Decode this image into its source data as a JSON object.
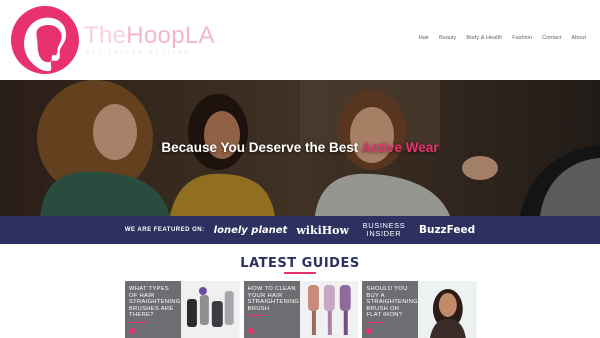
{
  "brand": {
    "logo_the": "The",
    "logo_name": "HoopLA",
    "tagline": "ALL THINGS STYLISH",
    "accent_color": "#e8326d"
  },
  "nav": {
    "items": [
      "Hair",
      "Beauty",
      "Body & Health",
      "Fashion",
      "Contact",
      "About"
    ]
  },
  "hero": {
    "headline_main": "Because You Deserve the Best",
    "headline_accent": "Active Wear"
  },
  "featured": {
    "label": "WE ARE FEATURED ON:",
    "brands": [
      "lonely planet",
      "wikiHow",
      "BUSINESS INSIDER",
      "BuzzFeed"
    ]
  },
  "guides": {
    "title": "LATEST GUIDES",
    "cards": [
      {
        "title": "WHAT TYPES OF HAIR STRAIGHTENING BRUSHES ARE THERE?"
      },
      {
        "title": "HOW TO CLEAN YOUR HAIR STRAIGHTENING BRUSH"
      },
      {
        "title": "SHOULD YOU BUY A STRAIGHTENING BRUSH OR FLAT IRON?"
      }
    ]
  }
}
